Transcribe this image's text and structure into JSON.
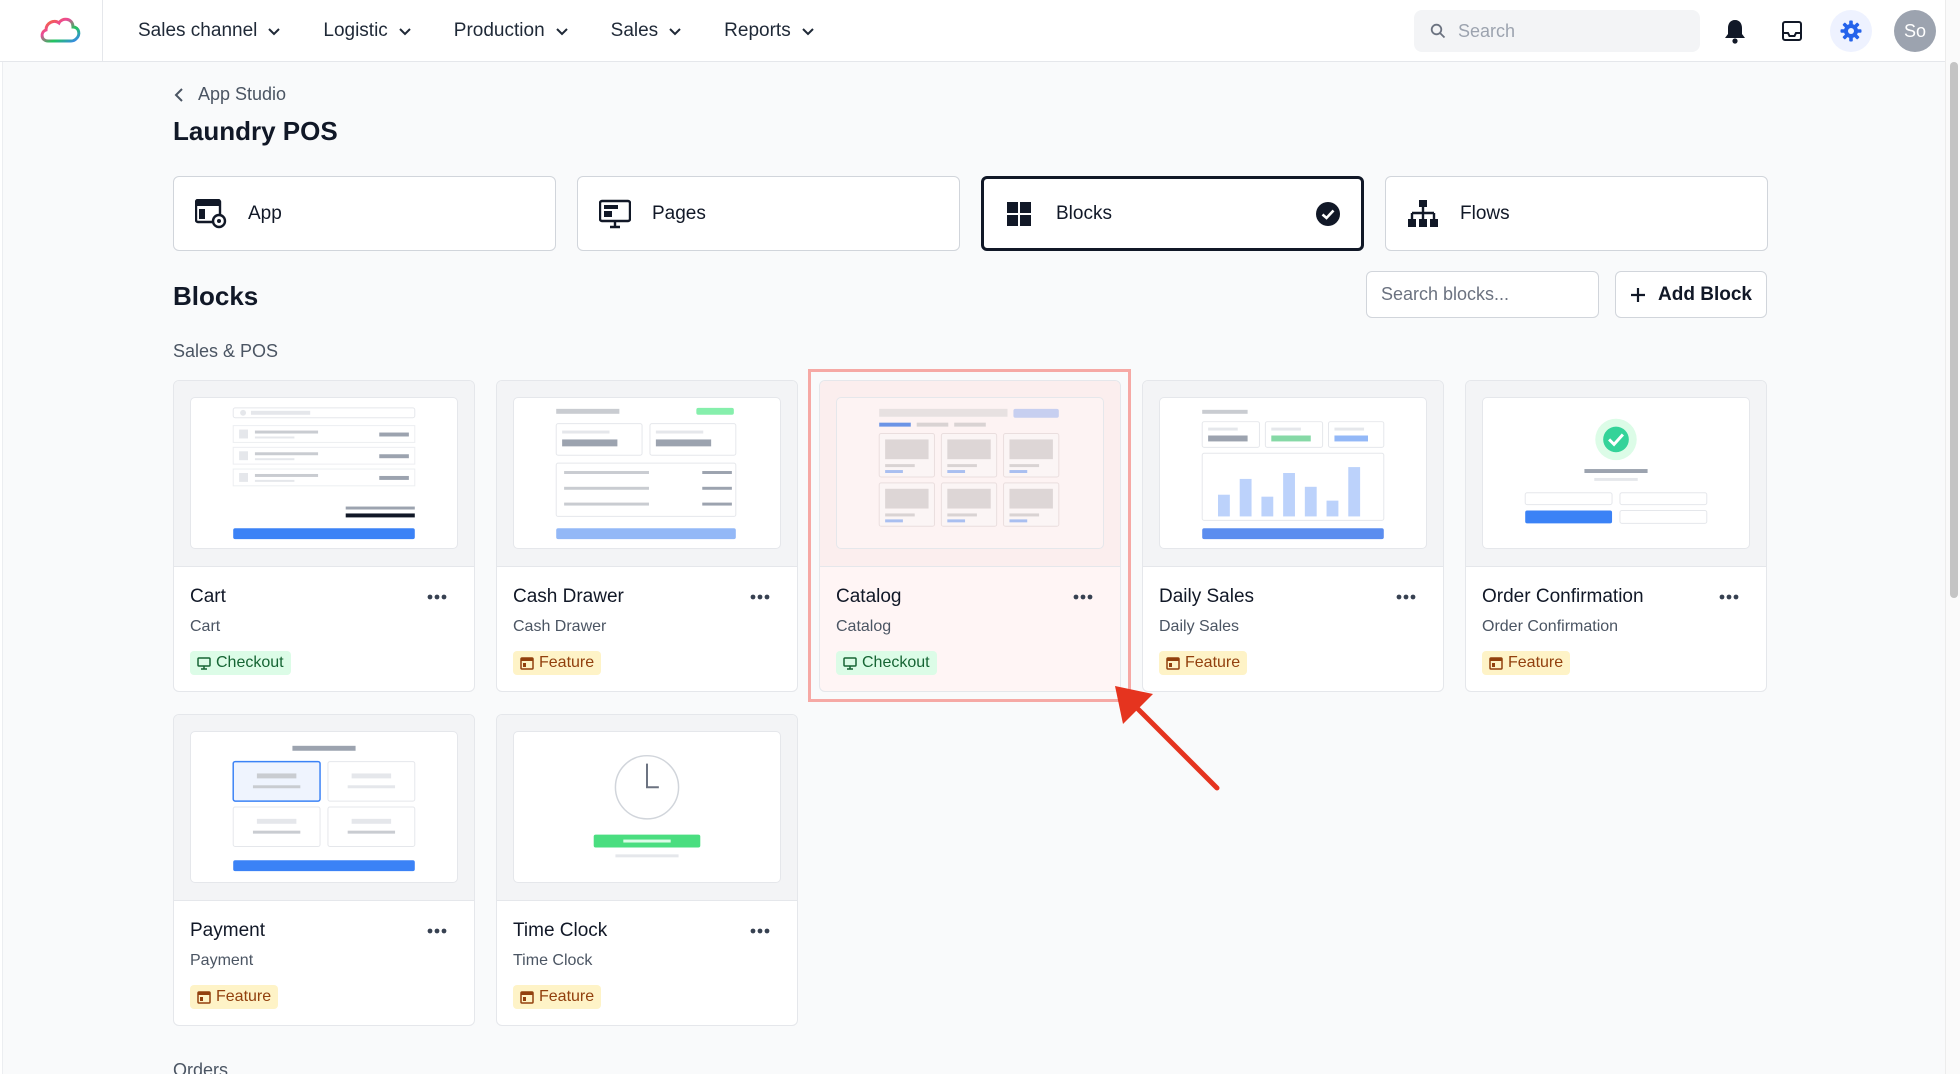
{
  "topbar": {
    "nav": [
      {
        "label": "Sales channel"
      },
      {
        "label": "Logistic"
      },
      {
        "label": "Production"
      },
      {
        "label": "Sales"
      },
      {
        "label": "Reports"
      }
    ],
    "search_placeholder": "Search",
    "avatar_initials": "So",
    "accent_color": "#2563eb"
  },
  "breadcrumb": {
    "label": "App Studio"
  },
  "page_title": "Laundry POS",
  "tabs": [
    {
      "label": "App",
      "icon": "app-settings-icon"
    },
    {
      "label": "Pages",
      "icon": "monitor-icon"
    },
    {
      "label": "Blocks",
      "icon": "grid-icon",
      "active": true
    },
    {
      "label": "Flows",
      "icon": "sitemap-icon"
    }
  ],
  "blocks_section": {
    "title": "Blocks",
    "search_placeholder": "Search blocks...",
    "add_label": "Add Block"
  },
  "group": {
    "label": "Sales & POS",
    "cards": [
      {
        "name": "Cart",
        "subtitle": "Cart",
        "badge": "Checkout",
        "badge_type": "checkout"
      },
      {
        "name": "Cash Drawer",
        "subtitle": "Cash Drawer",
        "badge": "Feature",
        "badge_type": "feature"
      },
      {
        "name": "Catalog",
        "subtitle": "Catalog",
        "badge": "Checkout",
        "badge_type": "checkout",
        "highlighted": true
      },
      {
        "name": "Daily Sales",
        "subtitle": "Daily Sales",
        "badge": "Feature",
        "badge_type": "feature"
      },
      {
        "name": "Order Confirmation",
        "subtitle": "Order Confirmation",
        "badge": "Feature",
        "badge_type": "feature"
      },
      {
        "name": "Payment",
        "subtitle": "Payment",
        "badge": "Feature",
        "badge_type": "feature"
      },
      {
        "name": "Time Clock",
        "subtitle": "Time Clock",
        "badge": "Feature",
        "badge_type": "feature"
      }
    ]
  },
  "next_group_label": "Orders",
  "colors": {
    "checkout_badge_bg": "#dcfce7",
    "feature_badge_bg": "#fef3c7",
    "highlight_outline": "#f6a9a5",
    "annotation_arrow": "#e5341f"
  }
}
